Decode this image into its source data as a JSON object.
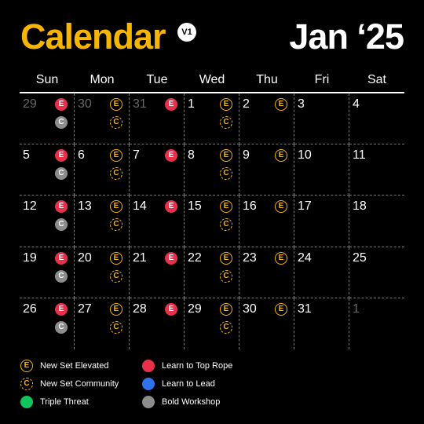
{
  "header": {
    "title": "Calendar",
    "version": "V1",
    "month": "Jan ‘25"
  },
  "weekdays": [
    "Sun",
    "Mon",
    "Tue",
    "Wed",
    "Thu",
    "Fri",
    "Sat"
  ],
  "colors": {
    "accent": "#f7b500",
    "learn_to_top_rope": "#e8304a",
    "learn_to_lead": "#2f72ee",
    "triple_threat": "#12c45d",
    "bold_workshop": "#8d8d8d"
  },
  "days": [
    {
      "label": "29",
      "muted": true,
      "events": [
        "red-e",
        "gray-c"
      ]
    },
    {
      "label": "30",
      "muted": true,
      "events": [
        "gold-e",
        "gold-dashed-c"
      ]
    },
    {
      "label": "31",
      "muted": true,
      "events": [
        "red-e"
      ]
    },
    {
      "label": "1",
      "events": [
        "gold-e",
        "gold-dashed-c"
      ]
    },
    {
      "label": "2",
      "events": [
        "gold-e"
      ]
    },
    {
      "label": "3",
      "events": []
    },
    {
      "label": "4",
      "events": []
    },
    {
      "label": "5",
      "events": [
        "red-e",
        "gray-c"
      ]
    },
    {
      "label": "6",
      "events": [
        "gold-e",
        "gold-dashed-c"
      ]
    },
    {
      "label": "7",
      "events": [
        "red-e"
      ]
    },
    {
      "label": "8",
      "events": [
        "gold-e",
        "gold-dashed-c"
      ]
    },
    {
      "label": "9",
      "events": [
        "gold-e"
      ]
    },
    {
      "label": "10",
      "events": []
    },
    {
      "label": "11",
      "events": []
    },
    {
      "label": "12",
      "events": [
        "red-e",
        "gray-c"
      ]
    },
    {
      "label": "13",
      "events": [
        "gold-e",
        "gold-dashed-c"
      ]
    },
    {
      "label": "14",
      "events": [
        "red-e"
      ]
    },
    {
      "label": "15",
      "events": [
        "gold-e",
        "gold-dashed-c"
      ]
    },
    {
      "label": "16",
      "events": [
        "gold-e"
      ]
    },
    {
      "label": "17",
      "events": []
    },
    {
      "label": "18",
      "events": []
    },
    {
      "label": "19",
      "events": [
        "red-e",
        "gray-c"
      ]
    },
    {
      "label": "20",
      "events": [
        "gold-e",
        "gold-dashed-c"
      ]
    },
    {
      "label": "21",
      "events": [
        "red-e"
      ]
    },
    {
      "label": "22",
      "events": [
        "gold-e",
        "gold-dashed-c"
      ]
    },
    {
      "label": "23",
      "events": [
        "gold-e"
      ]
    },
    {
      "label": "24",
      "events": []
    },
    {
      "label": "25",
      "events": []
    },
    {
      "label": "26",
      "events": [
        "red-e",
        "gray-c"
      ]
    },
    {
      "label": "27",
      "events": [
        "gold-e",
        "gold-dashed-c"
      ]
    },
    {
      "label": "28",
      "events": [
        "red-e"
      ]
    },
    {
      "label": "29",
      "events": [
        "gold-e",
        "gold-dashed-c"
      ]
    },
    {
      "label": "30",
      "events": [
        "gold-e"
      ]
    },
    {
      "label": "31",
      "events": []
    },
    {
      "label": "1",
      "muted": true,
      "events": []
    }
  ],
  "legend": [
    {
      "label": "New Set Elevated",
      "icon": "gold-e"
    },
    {
      "label": "Learn to Top Rope",
      "icon": "red-dot"
    },
    {
      "label": "New Set Community",
      "icon": "gold-dashed-c"
    },
    {
      "label": "Learn to Lead",
      "icon": "blue-dot"
    },
    {
      "label": "Triple Threat",
      "icon": "green-dot"
    },
    {
      "label": "Bold Workshop",
      "icon": "gray-dot"
    }
  ],
  "badge_letters": {
    "e": "E",
    "c": "C"
  }
}
